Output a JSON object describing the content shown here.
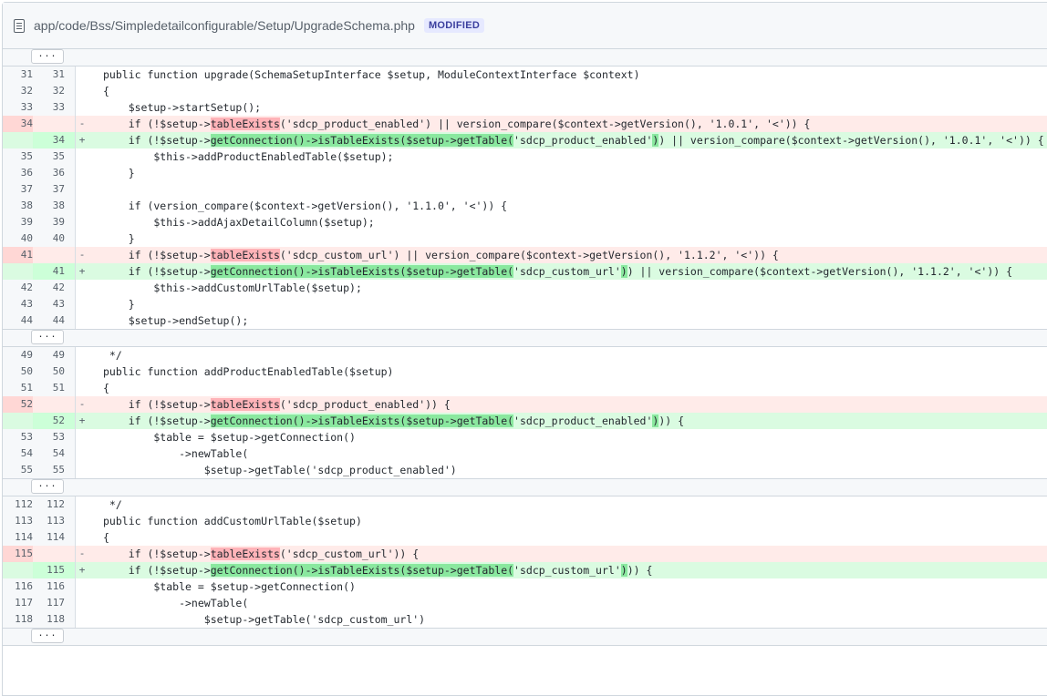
{
  "file": {
    "path": "app/code/Bss/Simpledetailconfigurable/Setup/UpgradeSchema.php",
    "status": "MODIFIED",
    "icon": "file-icon"
  },
  "expand_label": "...",
  "hunks": [
    {
      "lines": [
        {
          "t": "ctx",
          "o": "31",
          "n": "31",
          "s": [
            {
              "x": "public function upgrade(SchemaSetupInterface $setup, ModuleContextInterface $context)"
            }
          ]
        },
        {
          "t": "ctx",
          "o": "32",
          "n": "32",
          "s": [
            {
              "x": "{"
            }
          ]
        },
        {
          "t": "ctx",
          "o": "33",
          "n": "33",
          "s": [
            {
              "x": "    $setup->startSetup();"
            }
          ]
        },
        {
          "t": "del",
          "o": "34",
          "n": "",
          "s": [
            {
              "x": "    if (!$setup->"
            },
            {
              "x": "tableExists",
              "h": 1
            },
            {
              "x": "('sdcp_product_enabled') || version_compare($context->getVersion(), '1.0.1', '<')) {"
            }
          ]
        },
        {
          "t": "add",
          "o": "",
          "n": "34",
          "s": [
            {
              "x": "    if (!$setup->"
            },
            {
              "x": "getConnection",
              "h": 1
            },
            {
              "x": "()->isTableExists($setup->getTable(",
              "h": 1
            },
            {
              "x": "'sdcp_product_enabled'"
            },
            {
              "x": ")",
              "h": 1
            },
            {
              "x": ") || version_compare($context->getVersion(), '1.0.1', '<')) {"
            }
          ]
        },
        {
          "t": "ctx",
          "o": "35",
          "n": "35",
          "s": [
            {
              "x": "        $this->addProductEnabledTable($setup);"
            }
          ]
        },
        {
          "t": "ctx",
          "o": "36",
          "n": "36",
          "s": [
            {
              "x": "    }"
            }
          ]
        },
        {
          "t": "ctx",
          "o": "37",
          "n": "37",
          "s": [
            {
              "x": ""
            }
          ]
        },
        {
          "t": "ctx",
          "o": "38",
          "n": "38",
          "s": [
            {
              "x": "    if (version_compare($context->getVersion(), '1.1.0', '<')) {"
            }
          ]
        },
        {
          "t": "ctx",
          "o": "39",
          "n": "39",
          "s": [
            {
              "x": "        $this->addAjaxDetailColumn($setup);"
            }
          ]
        },
        {
          "t": "ctx",
          "o": "40",
          "n": "40",
          "s": [
            {
              "x": "    }"
            }
          ]
        },
        {
          "t": "del",
          "o": "41",
          "n": "",
          "s": [
            {
              "x": "    if (!$setup->"
            },
            {
              "x": "tableExists",
              "h": 1
            },
            {
              "x": "('sdcp_custom_url') || version_compare($context->getVersion(), '1.1.2', '<')) {"
            }
          ]
        },
        {
          "t": "add",
          "o": "",
          "n": "41",
          "s": [
            {
              "x": "    if (!$setup->"
            },
            {
              "x": "getConnection",
              "h": 1
            },
            {
              "x": "()->isTableExists($setup->getTable(",
              "h": 1
            },
            {
              "x": "'sdcp_custom_url'"
            },
            {
              "x": ")",
              "h": 1
            },
            {
              "x": ") || version_compare($context->getVersion(), '1.1.2', '<')) {"
            }
          ]
        },
        {
          "t": "ctx",
          "o": "42",
          "n": "42",
          "s": [
            {
              "x": "        $this->addCustomUrlTable($setup);"
            }
          ]
        },
        {
          "t": "ctx",
          "o": "43",
          "n": "43",
          "s": [
            {
              "x": "    }"
            }
          ]
        },
        {
          "t": "ctx",
          "o": "44",
          "n": "44",
          "s": [
            {
              "x": "    $setup->endSetup();"
            }
          ]
        }
      ]
    },
    {
      "lines": [
        {
          "t": "ctx",
          "o": "49",
          "n": "49",
          "s": [
            {
              "x": " */"
            }
          ]
        },
        {
          "t": "ctx",
          "o": "50",
          "n": "50",
          "s": [
            {
              "x": "public function addProductEnabledTable($setup)"
            }
          ]
        },
        {
          "t": "ctx",
          "o": "51",
          "n": "51",
          "s": [
            {
              "x": "{"
            }
          ]
        },
        {
          "t": "del",
          "o": "52",
          "n": "",
          "s": [
            {
              "x": "    if (!$setup->"
            },
            {
              "x": "tableExists",
              "h": 1
            },
            {
              "x": "('sdcp_product_enabled')) {"
            }
          ]
        },
        {
          "t": "add",
          "o": "",
          "n": "52",
          "s": [
            {
              "x": "    if (!$setup->"
            },
            {
              "x": "getConnection",
              "h": 1
            },
            {
              "x": "()->isTableExists($setup->getTable(",
              "h": 1
            },
            {
              "x": "'sdcp_product_enabled'"
            },
            {
              "x": ")",
              "h": 1
            },
            {
              "x": ")) {"
            }
          ]
        },
        {
          "t": "ctx",
          "o": "53",
          "n": "53",
          "s": [
            {
              "x": "        $table = $setup->getConnection()"
            }
          ]
        },
        {
          "t": "ctx",
          "o": "54",
          "n": "54",
          "s": [
            {
              "x": "            ->newTable("
            }
          ]
        },
        {
          "t": "ctx",
          "o": "55",
          "n": "55",
          "s": [
            {
              "x": "                $setup->getTable('sdcp_product_enabled')"
            }
          ]
        }
      ]
    },
    {
      "lines": [
        {
          "t": "ctx",
          "o": "112",
          "n": "112",
          "s": [
            {
              "x": " */"
            }
          ]
        },
        {
          "t": "ctx",
          "o": "113",
          "n": "113",
          "s": [
            {
              "x": "public function addCustomUrlTable($setup)"
            }
          ]
        },
        {
          "t": "ctx",
          "o": "114",
          "n": "114",
          "s": [
            {
              "x": "{"
            }
          ]
        },
        {
          "t": "del",
          "o": "115",
          "n": "",
          "s": [
            {
              "x": "    if (!$setup->"
            },
            {
              "x": "tableExists",
              "h": 1
            },
            {
              "x": "('sdcp_custom_url')) {"
            }
          ]
        },
        {
          "t": "add",
          "o": "",
          "n": "115",
          "s": [
            {
              "x": "    if (!$setup->"
            },
            {
              "x": "getConnection",
              "h": 1
            },
            {
              "x": "()->isTableExists($setup->getTable(",
              "h": 1
            },
            {
              "x": "'sdcp_custom_url'"
            },
            {
              "x": ")",
              "h": 1
            },
            {
              "x": ")) {"
            }
          ]
        },
        {
          "t": "ctx",
          "o": "116",
          "n": "116",
          "s": [
            {
              "x": "        $table = $setup->getConnection()"
            }
          ]
        },
        {
          "t": "ctx",
          "o": "117",
          "n": "117",
          "s": [
            {
              "x": "            ->newTable("
            }
          ]
        },
        {
          "t": "ctx",
          "o": "118",
          "n": "118",
          "s": [
            {
              "x": "                $setup->getTable('sdcp_custom_url')"
            }
          ]
        }
      ]
    }
  ],
  "colors": {
    "del_bg": "#ffebe9",
    "add_bg": "#dafbe1",
    "del_hl": "#ffb3b8",
    "add_hl": "#8ae89f",
    "badge_bg": "#e6e9ff",
    "badge_fg": "#3b3f9e"
  }
}
